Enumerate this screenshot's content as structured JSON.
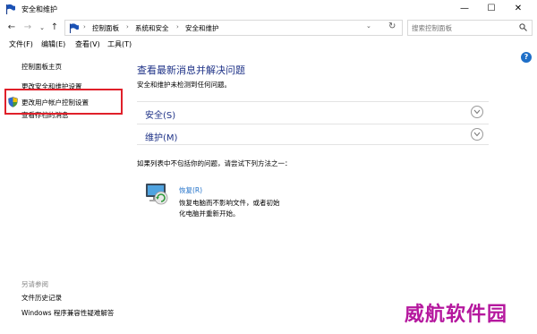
{
  "window": {
    "title": "安全和维护",
    "minimize": "—",
    "maximize": "☐",
    "close": "✕"
  },
  "nav": {
    "back": "←",
    "forward": "→",
    "recent": "⌄",
    "up": "↑"
  },
  "address": {
    "crumbs": [
      "控制面板",
      "系统和安全",
      "安全和维护"
    ],
    "separator": "›",
    "dropdown": "⌄",
    "refresh": "↻"
  },
  "search": {
    "placeholder": "搜索控制面板"
  },
  "menu": {
    "items": [
      "文件(F)",
      "编辑(E)",
      "查看(V)",
      "工具(T)"
    ]
  },
  "sidebar": {
    "links": [
      "控制面板主页",
      "更改安全和维护设置",
      "更改用户帐户控制设置",
      "查看存档的消息"
    ],
    "see_also_heading": "另请参阅",
    "see_also": [
      "文件历史记录",
      "Windows 程序兼容性疑难解答"
    ]
  },
  "help": "?",
  "main": {
    "title": "查看最新消息并解决问题",
    "subtitle": "安全和维护未检测到任何问题。",
    "sections": [
      "安全(S)",
      "维护(M)"
    ],
    "hint": "如果列表中不包括你的问题，请尝试下列方法之一：",
    "recovery": {
      "link": "恢复(R)",
      "description": [
        "恢复电脑而不影响文件，或者初始",
        "化电脑并重新开始。"
      ]
    }
  },
  "watermark": "威航软件园",
  "colors": {
    "link_blue": "#1e6fc8",
    "title_blue": "#1e3287",
    "highlight_red": "#e0202a",
    "watermark": "#b5179e"
  }
}
